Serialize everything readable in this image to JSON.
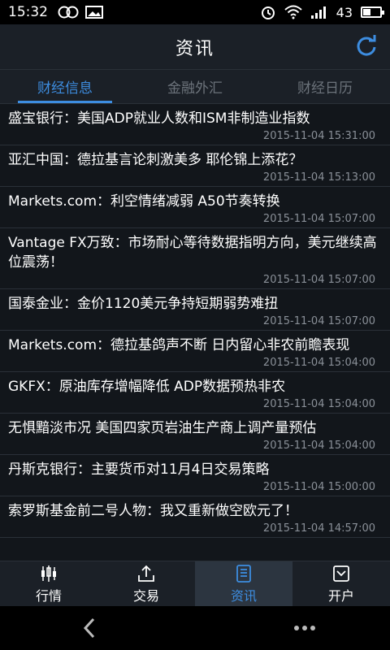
{
  "status_bar": {
    "time": "15:32",
    "battery": "43",
    "battery_level": 0.43
  },
  "header": {
    "title": "资讯"
  },
  "tabs": [
    {
      "label": "财经信息",
      "active": true
    },
    {
      "label": "金融外汇",
      "active": false
    },
    {
      "label": "财经日历",
      "active": false
    }
  ],
  "news": [
    {
      "headline": "盛宝银行：美国ADP就业人数和ISM非制造业指数",
      "time": "2015-11-04 15:31:00"
    },
    {
      "headline": "亚汇中国：德拉基言论刺激美多 耶伦锦上添花？",
      "time": "2015-11-04 15:13:00"
    },
    {
      "headline": "Markets.com：利空情绪减弱 A50节奏转换",
      "time": "2015-11-04 15:07:00"
    },
    {
      "headline": "Vantage FX万致：市场耐心等待数据指明方向，美元继续高位震荡！",
      "time": "2015-11-04 15:07:00"
    },
    {
      "headline": "国泰金业：金价1120美元争持短期弱势难扭",
      "time": "2015-11-04 15:07:00"
    },
    {
      "headline": "Markets.com：德拉基鸽声不断 日内留心非农前瞻表现",
      "time": "2015-11-04 15:04:00"
    },
    {
      "headline": "GKFX：原油库存增幅降低 ADP数据预热非农",
      "time": "2015-11-04 15:04:00"
    },
    {
      "headline": "无惧黯淡市况 美国四家页岩油生产商上调产量预估",
      "time": "2015-11-04 15:04:00"
    },
    {
      "headline": "丹斯克银行：主要货币对11月4日交易策略",
      "time": "2015-11-04 15:00:00"
    },
    {
      "headline": "索罗斯基金前二号人物：我又重新做空欧元了！",
      "time": "2015-11-04 14:57:00"
    }
  ],
  "bottom_nav": [
    {
      "label": "行情",
      "icon": "chart-icon",
      "active": false
    },
    {
      "label": "交易",
      "icon": "upload-icon",
      "active": false
    },
    {
      "label": "资讯",
      "icon": "document-icon",
      "active": true
    },
    {
      "label": "开户",
      "icon": "inbox-icon",
      "active": false
    }
  ],
  "colors": {
    "accent": "#3d8de0",
    "header_bg": "#1b2027",
    "list_bg": "#12161b"
  }
}
